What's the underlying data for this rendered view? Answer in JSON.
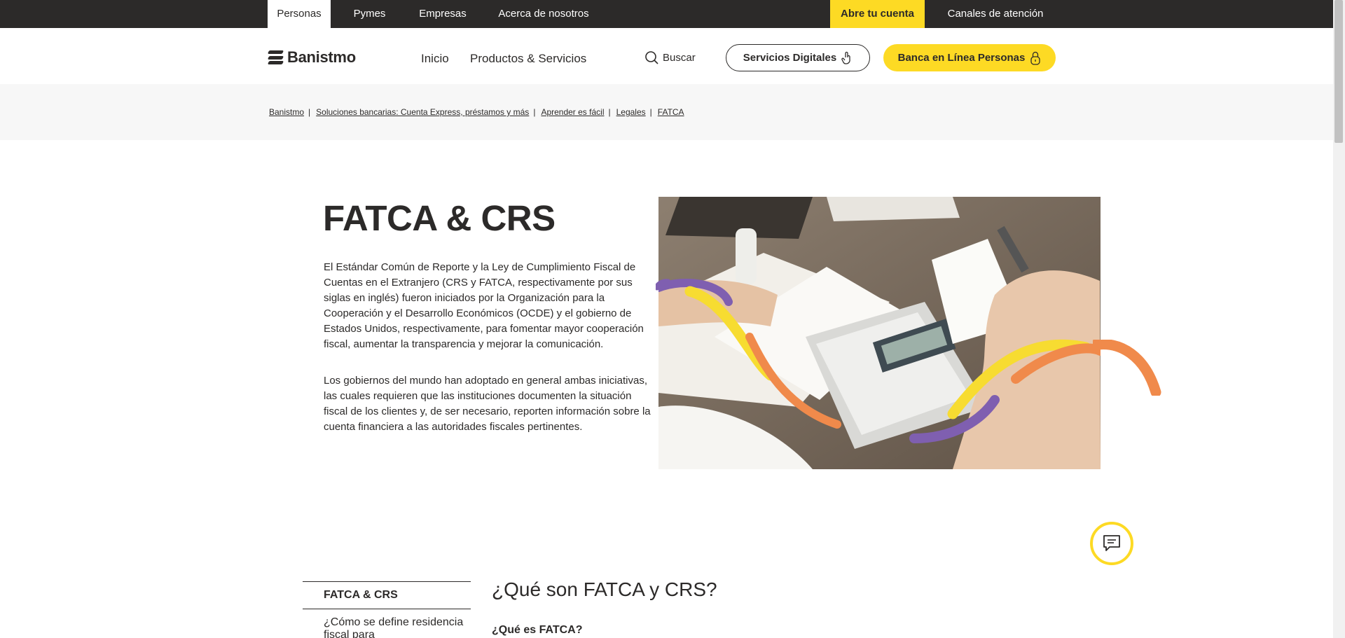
{
  "topbar": {
    "tabs": [
      "Personas",
      "Pymes",
      "Empresas",
      "Acerca de nosotros"
    ],
    "open_account": "Abre tu cuenta",
    "channels": "Canales de atención"
  },
  "header": {
    "logo_text": "Banistmo",
    "nav": [
      "Inicio",
      "Productos & Servicios"
    ],
    "search_label": "Buscar",
    "digital_button": "Servicios Digitales",
    "online_button": "Banca en Línea Personas"
  },
  "breadcrumb": [
    "Banistmo",
    "Soluciones bancarias: Cuenta Express, préstamos y más",
    "Aprender es fácil",
    "Legales",
    "FATCA"
  ],
  "hero": {
    "title": "FATCA & CRS",
    "paragraph1": "El Estándar Común de Reporte y la Ley de Cumplimiento Fiscal de Cuentas en el Extranjero (CRS y FATCA, respectivamente por sus siglas en inglés) fueron iniciados por la Organización para la Cooperación y el Desarrollo Económicos (OCDE) y el gobierno de Estados Unidos, respectivamente, para fomentar mayor cooperación fiscal, aumentar la transparencia y mejorar la comunicación.",
    "paragraph2": "Los gobiernos del mundo han adoptado en general ambas iniciativas, las cuales requieren que las instituciones documenten la situación fiscal de los clientes y, de ser necesario, reporten información sobre la cuenta financiera a las autoridades fiscales pertinentes."
  },
  "sidenav": [
    "FATCA & CRS",
    "¿Cómo se define residencia fiscal para"
  ],
  "section": {
    "title": "¿Qué son FATCA y CRS?",
    "subtitle": "¿Qué es FATCA?"
  },
  "colors": {
    "brand_yellow": "#fdda24",
    "dark": "#2c2a29",
    "purple": "#7f5fb0",
    "orange": "#f08a4b"
  }
}
